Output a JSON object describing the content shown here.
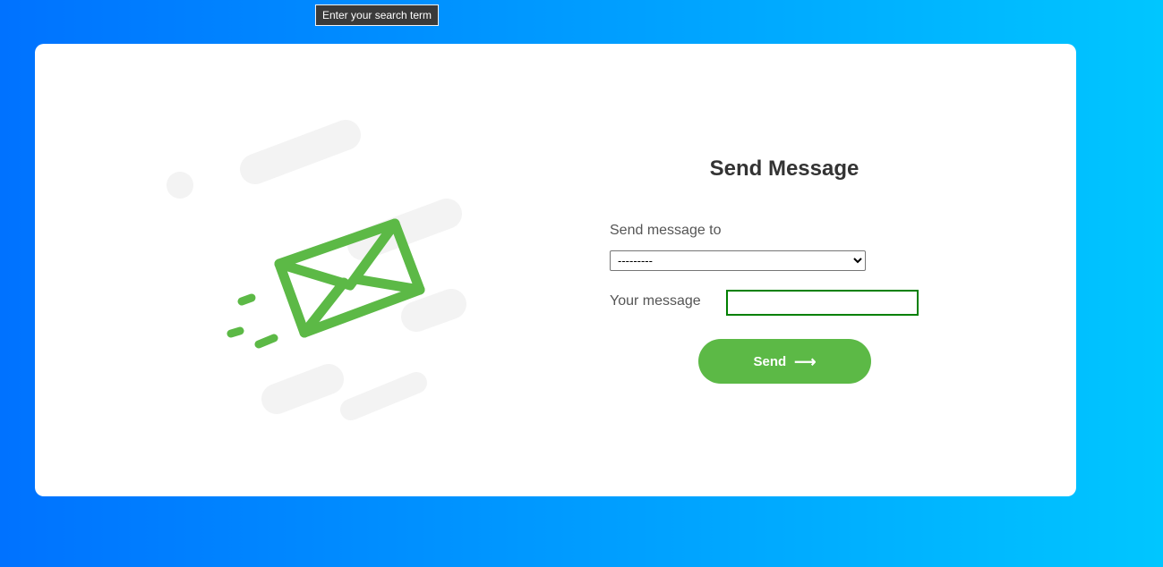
{
  "tooltip": {
    "text": "Enter your search term"
  },
  "form": {
    "title": "Send Message",
    "send_to_label": "Send message to",
    "recipient_selected": "---------",
    "message_label": "Your message",
    "message_value": "",
    "send_label": "Send",
    "send_icon": "arrow-right-icon"
  },
  "illustration": {
    "icon": "envelope-icon"
  },
  "colors": {
    "accent_green": "#5cb946",
    "focus_outline": "#008000",
    "gradient_start": "#0072ff",
    "gradient_end": "#00c6ff"
  }
}
